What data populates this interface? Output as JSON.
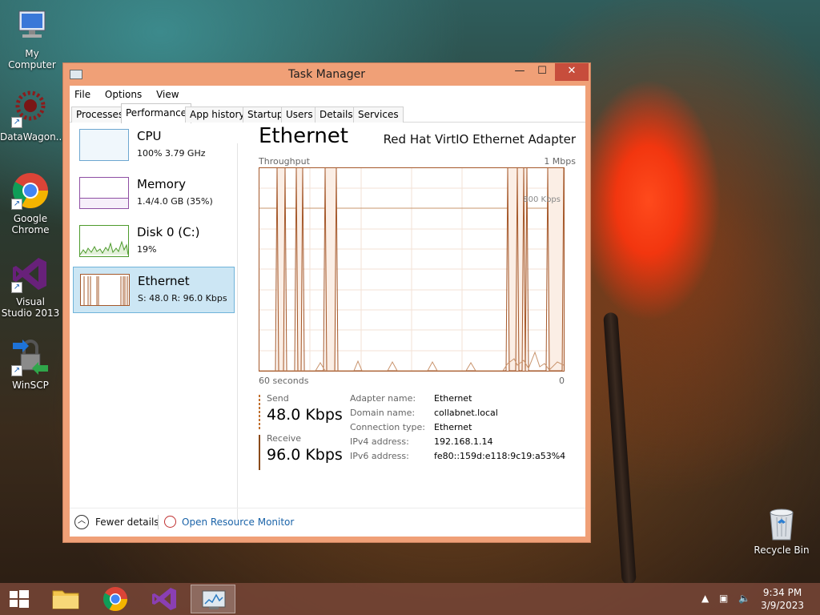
{
  "desktop": {
    "icons": [
      {
        "label": "My Computer"
      },
      {
        "label": "DataWagon..."
      },
      {
        "label": "Google Chrome"
      },
      {
        "label": "Visual Studio 2013"
      },
      {
        "label": "WinSCP"
      }
    ],
    "recycle_bin": {
      "label": "Recycle Bin"
    }
  },
  "window": {
    "title": "Task Manager",
    "close_glyph": "✕",
    "max_glyph": "☐",
    "min_glyph": "—"
  },
  "menu": {
    "file": "File",
    "options": "Options",
    "view": "View"
  },
  "tabs": [
    "Processes",
    "Performance",
    "App history",
    "Startup",
    "Users",
    "Details",
    "Services"
  ],
  "sidebar": {
    "items": [
      {
        "name": "CPU",
        "sub": "100%  3.79 GHz"
      },
      {
        "name": "Memory",
        "sub": "1.4/4.0 GB (35%)"
      },
      {
        "name": "Disk 0 (C:)",
        "sub": "19%"
      },
      {
        "name": "Ethernet",
        "sub": "S: 48.0  R: 96.0 Kbps"
      }
    ]
  },
  "main": {
    "heading": "Ethernet",
    "adapter": "Red Hat VirtIO Ethernet Adapter",
    "throughput_label": "Throughput",
    "max_label": "1 Mbps",
    "mark_label": "800 Kbps",
    "x_left": "60 seconds",
    "x_right": "0",
    "send_label": "Send",
    "send_value": "48.0 Kbps",
    "receive_label": "Receive",
    "receive_value": "96.0 Kbps",
    "send_color": "#c0702f",
    "receive_color": "#8a4a1a",
    "properties": [
      {
        "key": "Adapter name:",
        "value": "Ethernet"
      },
      {
        "key": "Domain name:",
        "value": "collabnet.local"
      },
      {
        "key": "Connection type:",
        "value": "Ethernet"
      },
      {
        "key": "IPv4 address:",
        "value": "192.168.1.14"
      },
      {
        "key": "IPv6 address:",
        "value": "fe80::159d:e118:9c19:a53%4"
      }
    ]
  },
  "footer": {
    "fewer": "Fewer details",
    "resmon": "Open Resource Monitor"
  },
  "taskbar": {
    "time": "9:34 PM",
    "date": "3/9/2023"
  },
  "colors": {
    "accent": "#f0a077",
    "selected": "#cce6f4",
    "link": "#1a63a8"
  }
}
